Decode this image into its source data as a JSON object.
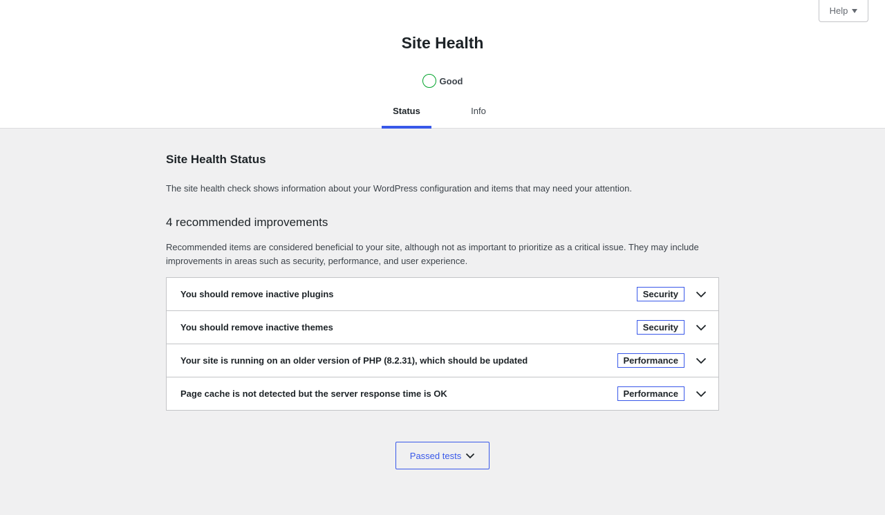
{
  "help": {
    "label": "Help",
    "icon": "caret-down-icon"
  },
  "page": {
    "title": "Site Health"
  },
  "rating": {
    "label": "Good",
    "color": "#00a32a"
  },
  "tabs": [
    {
      "label": "Status",
      "active": true
    },
    {
      "label": "Info",
      "active": false
    }
  ],
  "status": {
    "title": "Site Health Status",
    "intro": "The site health check shows information about your WordPress configuration and items that may need your attention.",
    "recommended_title": "4 recommended improvements",
    "recommended_desc": "Recommended items are considered beneficial to your site, although not as important to prioritize as a critical issue. They may include improvements in areas such as security, performance, and user experience.",
    "items": [
      {
        "title": "You should remove inactive plugins",
        "badge": "Security"
      },
      {
        "title": "You should remove inactive themes",
        "badge": "Security"
      },
      {
        "title": "Your site is running on an older version of PHP (8.2.31), which should be updated",
        "badge": "Performance"
      },
      {
        "title": "Page cache is not detected but the server response time is OK",
        "badge": "Performance"
      }
    ]
  },
  "passed": {
    "label": "Passed tests",
    "icon": "chevron-down-icon"
  },
  "colors": {
    "accent": "#3858e9",
    "good": "#00a32a",
    "background": "#f0f0f1"
  }
}
